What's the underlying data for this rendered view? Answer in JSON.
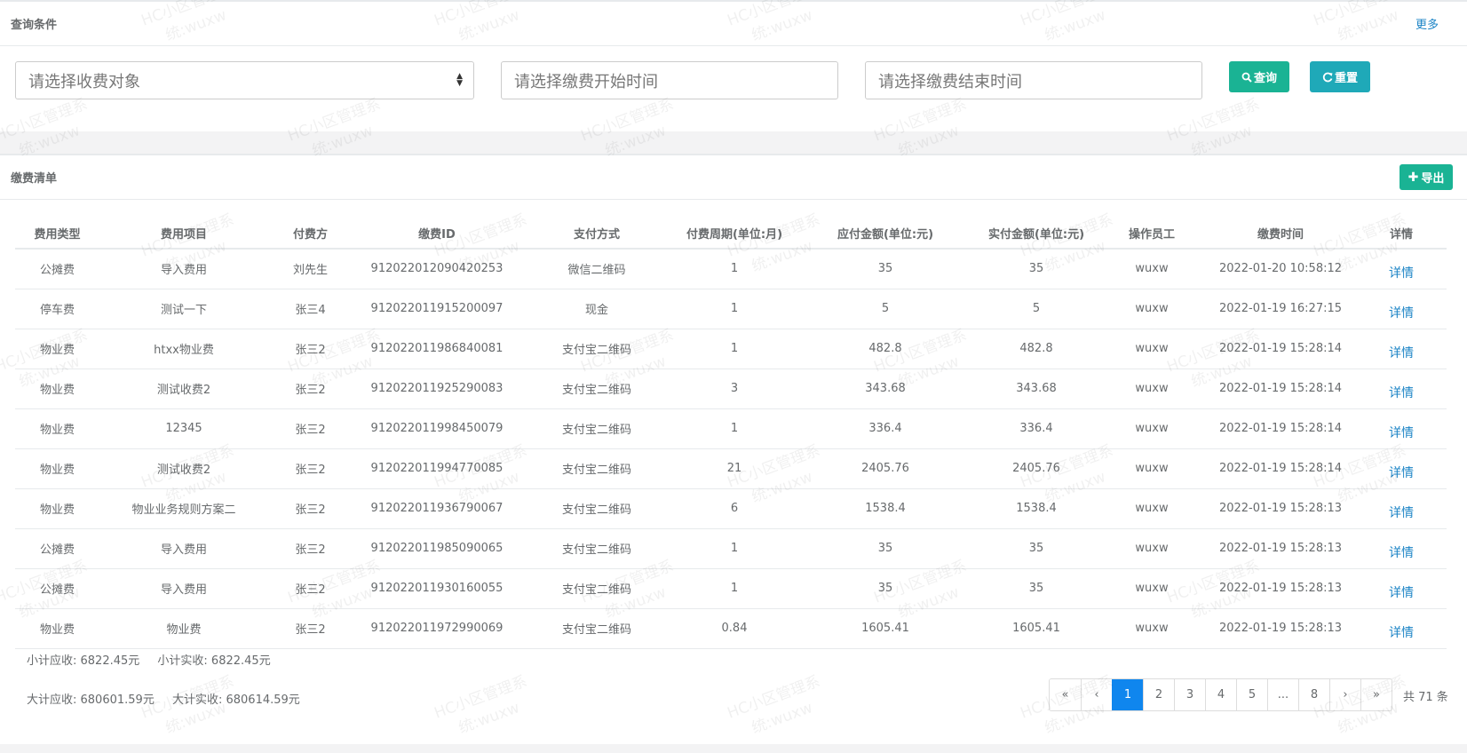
{
  "query": {
    "title": "查询条件",
    "more_label": "更多",
    "fee_object_placeholder": "请选择收费对象",
    "start_time_placeholder": "请选择缴费开始时间",
    "end_time_placeholder": "请选择缴费结束时间",
    "query_label": "查询",
    "reset_label": "重置"
  },
  "list": {
    "title": "缴费清单",
    "export_label": "导出",
    "columns": [
      "费用类型",
      "费用项目",
      "付费方",
      "缴费ID",
      "支付方式",
      "付费周期(单位:月)",
      "应付金额(单位:元)",
      "实付金额(单位:元)",
      "操作员工",
      "缴费时间",
      "详情"
    ],
    "rows": [
      [
        "公摊费",
        "导入费用",
        "刘先生",
        "912022012090420253",
        "微信二维码",
        "1",
        "35",
        "35",
        "wuxw",
        "2022-01-20 10:58:12",
        "详情"
      ],
      [
        "停车费",
        "测试一下",
        "张三4",
        "912022011915200097",
        "现金",
        "1",
        "5",
        "5",
        "wuxw",
        "2022-01-19 16:27:15",
        "详情"
      ],
      [
        "物业费",
        "htxx物业费",
        "张三2",
        "912022011986840081",
        "支付宝二维码",
        "1",
        "482.8",
        "482.8",
        "wuxw",
        "2022-01-19 15:28:14",
        "详情"
      ],
      [
        "物业费",
        "测试收费2",
        "张三2",
        "912022011925290083",
        "支付宝二维码",
        "3",
        "343.68",
        "343.68",
        "wuxw",
        "2022-01-19 15:28:14",
        "详情"
      ],
      [
        "物业费",
        "12345",
        "张三2",
        "912022011998450079",
        "支付宝二维码",
        "1",
        "336.4",
        "336.4",
        "wuxw",
        "2022-01-19 15:28:14",
        "详情"
      ],
      [
        "物业费",
        "测试收费2",
        "张三2",
        "912022011994770085",
        "支付宝二维码",
        "21",
        "2405.76",
        "2405.76",
        "wuxw",
        "2022-01-19 15:28:14",
        "详情"
      ],
      [
        "物业费",
        "物业业务规则方案二",
        "张三2",
        "912022011936790067",
        "支付宝二维码",
        "6",
        "1538.4",
        "1538.4",
        "wuxw",
        "2022-01-19 15:28:13",
        "详情"
      ],
      [
        "公摊费",
        "导入费用",
        "张三2",
        "912022011985090065",
        "支付宝二维码",
        "1",
        "35",
        "35",
        "wuxw",
        "2022-01-19 15:28:13",
        "详情"
      ],
      [
        "公摊费",
        "导入费用",
        "张三2",
        "912022011930160055",
        "支付宝二维码",
        "1",
        "35",
        "35",
        "wuxw",
        "2022-01-19 15:28:13",
        "详情"
      ],
      [
        "物业费",
        "物业费",
        "张三2",
        "912022011972990069",
        "支付宝二维码",
        "0.84",
        "1605.41",
        "1605.41",
        "wuxw",
        "2022-01-19 15:28:13",
        "详情"
      ]
    ],
    "subtotal_receivable": "小计应收: 6822.45元",
    "subtotal_received": "小计实收: 6822.45元",
    "total_receivable": "大计应收: 680601.59元",
    "total_received": "大计实收: 680614.59元",
    "pagination": {
      "pages": [
        "«",
        "‹",
        "1",
        "2",
        "3",
        "4",
        "5",
        "...",
        "8",
        "›",
        "»"
      ],
      "active": "1",
      "total": "共 71 条"
    }
  },
  "watermark": {
    "line1": "HC小区管理系",
    "line2": "统:wuxw"
  },
  "colors": {
    "primary": "#1ab394",
    "info": "#1fa9b8",
    "link": "#1c84c6",
    "active_page": "#0f86ee"
  }
}
